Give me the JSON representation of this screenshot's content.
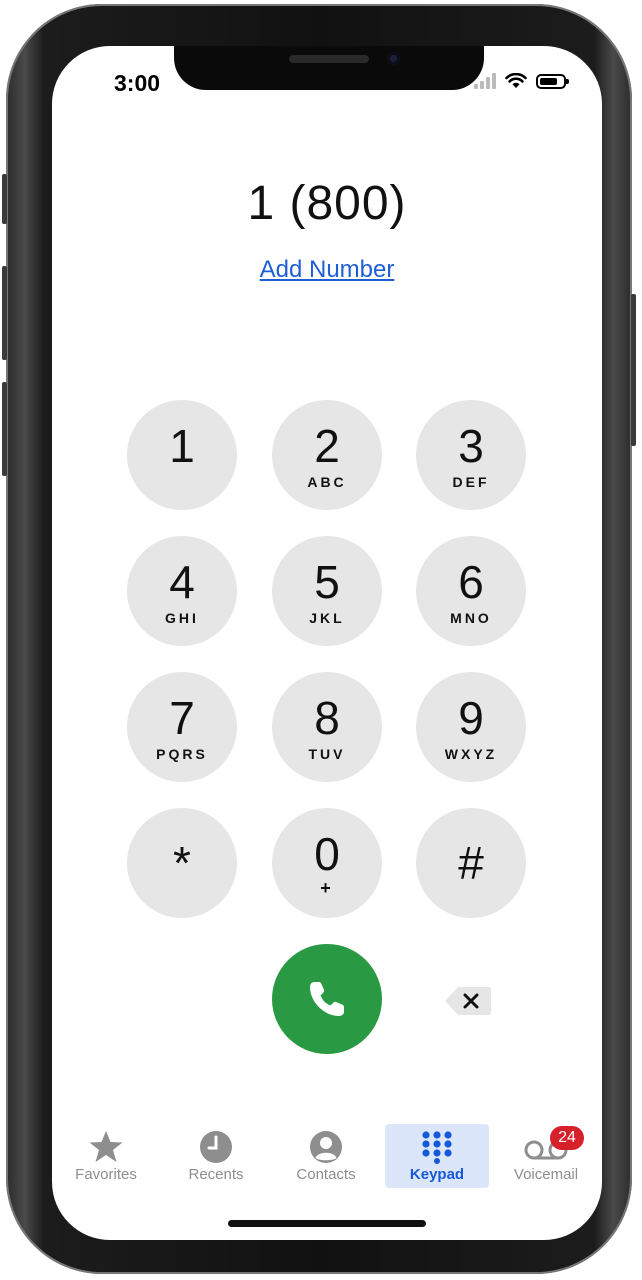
{
  "status_bar": {
    "time": "3:00"
  },
  "dialer": {
    "number": "1 (800)",
    "add_number_link": "Add Number"
  },
  "keypad": {
    "keys": [
      {
        "digit": "1",
        "letters": ""
      },
      {
        "digit": "2",
        "letters": "ABC"
      },
      {
        "digit": "3",
        "letters": "DEF"
      },
      {
        "digit": "4",
        "letters": "GHI"
      },
      {
        "digit": "5",
        "letters": "JKL"
      },
      {
        "digit": "6",
        "letters": "MNO"
      },
      {
        "digit": "7",
        "letters": "PQRS"
      },
      {
        "digit": "8",
        "letters": "TUV"
      },
      {
        "digit": "9",
        "letters": "WXYZ"
      },
      {
        "digit": "*",
        "letters": ""
      },
      {
        "digit": "0",
        "letters": "+"
      },
      {
        "digit": "#",
        "letters": ""
      }
    ],
    "call_icon": "phone-icon",
    "delete_icon": "backspace-icon"
  },
  "tabs": [
    {
      "label": "Favorites",
      "icon": "star-icon"
    },
    {
      "label": "Recents",
      "icon": "clock-icon"
    },
    {
      "label": "Contacts",
      "icon": "person-icon"
    },
    {
      "label": "Keypad",
      "icon": "keypad-icon",
      "active": true
    },
    {
      "label": "Voicemail",
      "icon": "voicemail-icon",
      "badge": "24"
    }
  ],
  "colors": {
    "accent": "#1659d8",
    "call_green": "#2a9944",
    "key_gray": "#e6e6e6",
    "badge_red": "#d6202a",
    "active_tab_bg": "#dbe6fb"
  }
}
